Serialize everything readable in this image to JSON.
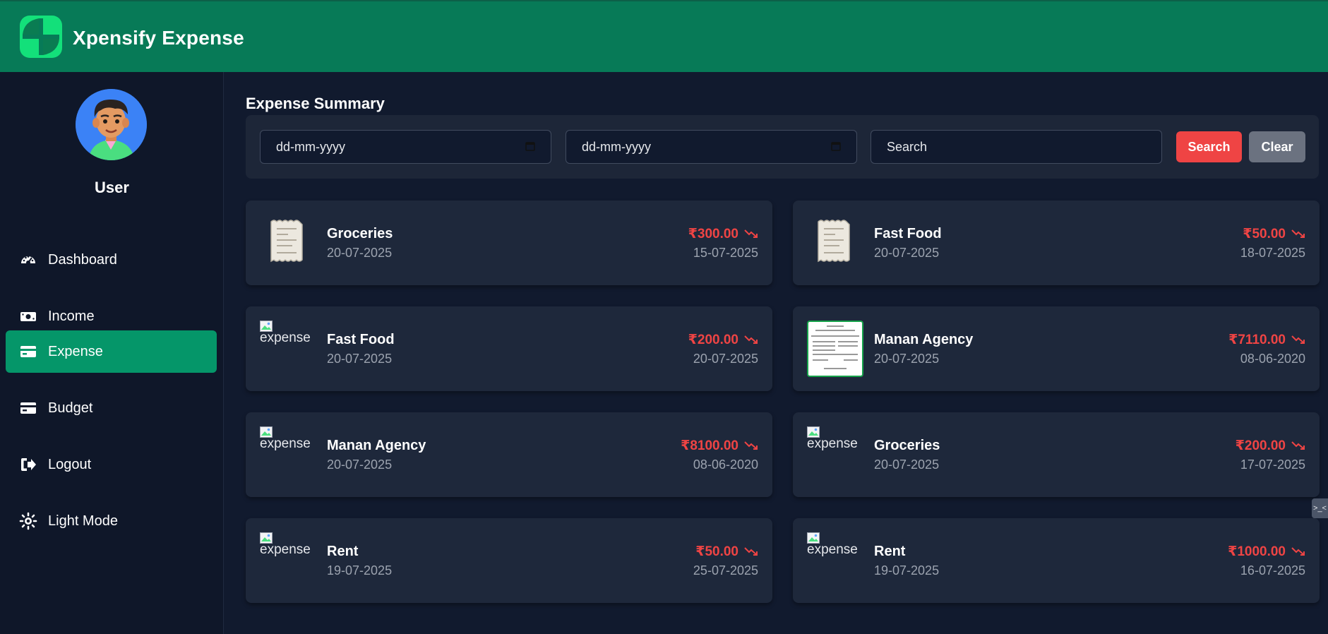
{
  "app": {
    "title": "Xpensify Expense"
  },
  "user": {
    "name": "User"
  },
  "nav": [
    {
      "label": "Dashboard",
      "icon": "dashboard-gauge-icon",
      "active": false
    },
    {
      "label": "Income",
      "icon": "money-bill-icon",
      "active": false
    },
    {
      "label": "Expense",
      "icon": "credit-card-icon",
      "active": true
    },
    {
      "label": "Budget",
      "icon": "credit-card-icon",
      "active": false
    },
    {
      "label": "Logout",
      "icon": "logout-icon",
      "active": false
    },
    {
      "label": "Light Mode",
      "icon": "sun-icon",
      "active": false
    }
  ],
  "main": {
    "title": "Expense Summary",
    "filters": {
      "from_date_placeholder": "dd-mm-yyyy",
      "to_date_placeholder": "dd-mm-yyyy",
      "search_placeholder": "Search",
      "search_button": "Search",
      "clear_button": "Clear"
    },
    "expenses": [
      {
        "name": "Groceries",
        "date": "20-07-2025",
        "amount": "₹300.00",
        "expense_date": "15-07-2025",
        "thumb": "receipt",
        "alt": "expense"
      },
      {
        "name": "Fast Food",
        "date": "20-07-2025",
        "amount": "₹50.00",
        "expense_date": "18-07-2025",
        "thumb": "receipt",
        "alt": "expense"
      },
      {
        "name": "Fast Food",
        "date": "20-07-2025",
        "amount": "₹200.00",
        "expense_date": "20-07-2025",
        "thumb": "broken",
        "alt": "expense"
      },
      {
        "name": "Manan Agency",
        "date": "20-07-2025",
        "amount": "₹7110.00",
        "expense_date": "08-06-2020",
        "thumb": "invoice",
        "alt": "expense"
      },
      {
        "name": "Manan Agency",
        "date": "20-07-2025",
        "amount": "₹8100.00",
        "expense_date": "08-06-2020",
        "thumb": "broken",
        "alt": "expense"
      },
      {
        "name": "Groceries",
        "date": "20-07-2025",
        "amount": "₹200.00",
        "expense_date": "17-07-2025",
        "thumb": "broken",
        "alt": "expense"
      },
      {
        "name": "Rent",
        "date": "19-07-2025",
        "amount": "₹50.00",
        "expense_date": "25-07-2025",
        "thumb": "broken",
        "alt": "expense"
      },
      {
        "name": "Rent",
        "date": "19-07-2025",
        "amount": "₹1000.00",
        "expense_date": "16-07-2025",
        "thumb": "broken",
        "alt": "expense"
      }
    ]
  },
  "colors": {
    "header": "#077a57",
    "active_nav": "#059669",
    "amount": "#ef4444",
    "search_button": "#ef4444",
    "clear_button": "#6b7280"
  }
}
